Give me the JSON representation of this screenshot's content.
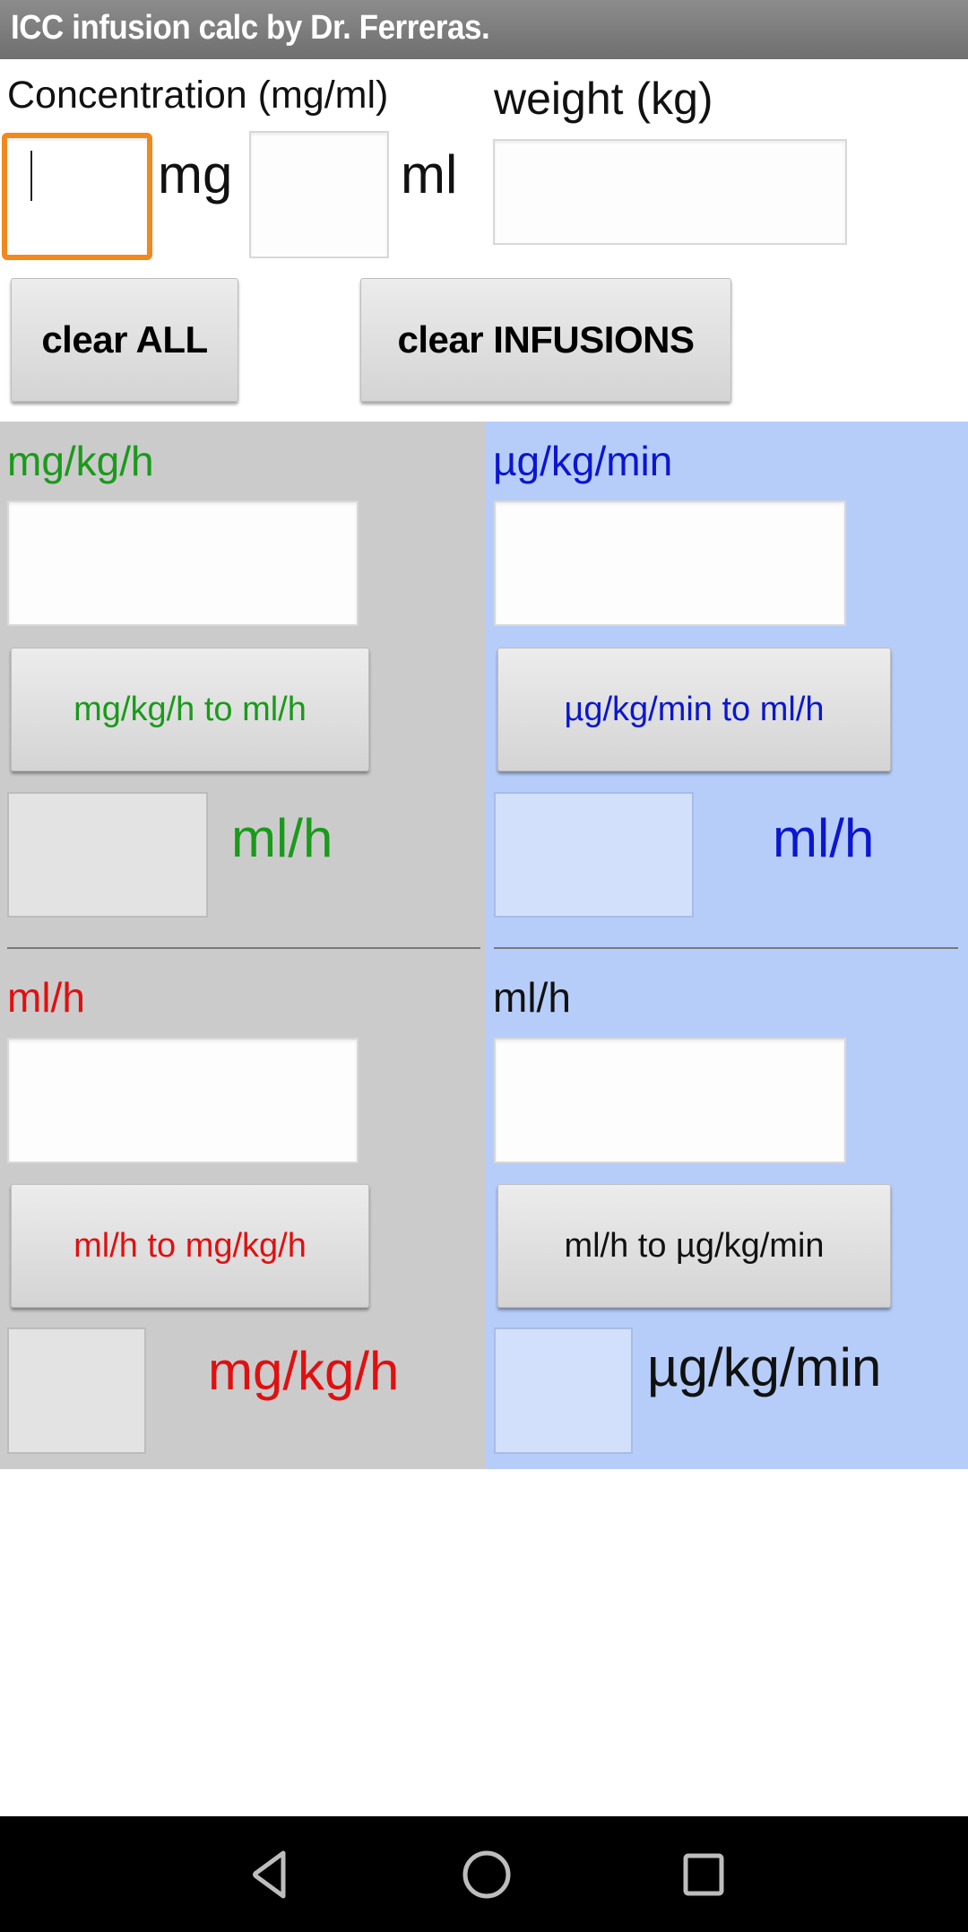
{
  "app": {
    "title": "ICC infusion calc by Dr. Ferreras."
  },
  "concentration": {
    "label": "Concentration (mg/ml)",
    "mg_value": "",
    "mg_unit": "mg",
    "ml_value": "",
    "ml_unit": "ml"
  },
  "weight": {
    "label": "weight (kg)",
    "value": ""
  },
  "actions": {
    "clear_all": "clear ALL",
    "clear_infusions": "clear INFUSIONS"
  },
  "left_panel": {
    "top": {
      "label": "mg/kg/h",
      "input_value": "",
      "button": "mg/kg/h to ml/h",
      "result_value": "",
      "result_unit": "ml/h"
    },
    "bottom": {
      "label": "ml/h",
      "input_value": "",
      "button": "ml/h to mg/kg/h",
      "result_value": "",
      "result_unit": "mg/kg/h"
    }
  },
  "right_panel": {
    "top": {
      "label": "µg/kg/min",
      "input_value": "",
      "button": "µg/kg/min to ml/h",
      "result_value": "",
      "result_unit": "ml/h"
    },
    "bottom": {
      "label": "ml/h",
      "input_value": "",
      "button": "ml/h to µg/kg/min",
      "result_value": "",
      "result_unit": "µg/kg/min"
    }
  },
  "colors": {
    "left_panel_bg": "#cbcbcb",
    "right_panel_bg": "#b7cdf9",
    "green": "#1a9a1a",
    "blue": "#0a16d0",
    "red": "#e01010",
    "focus": "#f0891e"
  },
  "navbar": {
    "back": "back-icon",
    "home": "home-icon",
    "recents": "recents-icon"
  }
}
